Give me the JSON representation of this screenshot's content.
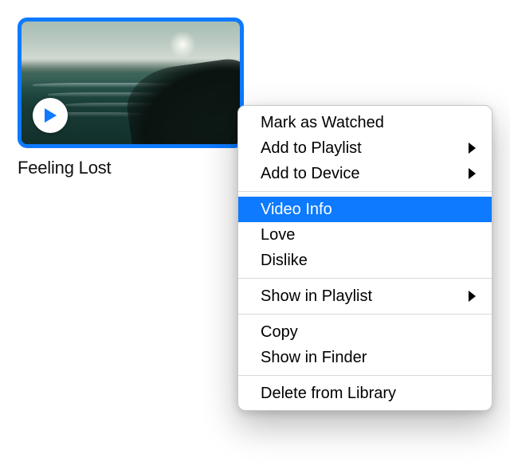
{
  "video": {
    "title": "Feeling Lost",
    "thumbnail_description": "coastal-cliffs-ocean",
    "selection_color": "#0d7aff"
  },
  "context_menu": {
    "highlight_color": "#0d7aff",
    "groups": [
      [
        {
          "label": "Mark as Watched",
          "submenu": false,
          "highlighted": false
        },
        {
          "label": "Add to Playlist",
          "submenu": true,
          "highlighted": false
        },
        {
          "label": "Add to Device",
          "submenu": true,
          "highlighted": false
        }
      ],
      [
        {
          "label": "Video Info",
          "submenu": false,
          "highlighted": true
        },
        {
          "label": "Love",
          "submenu": false,
          "highlighted": false
        },
        {
          "label": "Dislike",
          "submenu": false,
          "highlighted": false
        }
      ],
      [
        {
          "label": "Show in Playlist",
          "submenu": true,
          "highlighted": false
        }
      ],
      [
        {
          "label": "Copy",
          "submenu": false,
          "highlighted": false
        },
        {
          "label": "Show in Finder",
          "submenu": false,
          "highlighted": false
        }
      ],
      [
        {
          "label": "Delete from Library",
          "submenu": false,
          "highlighted": false
        }
      ]
    ]
  }
}
